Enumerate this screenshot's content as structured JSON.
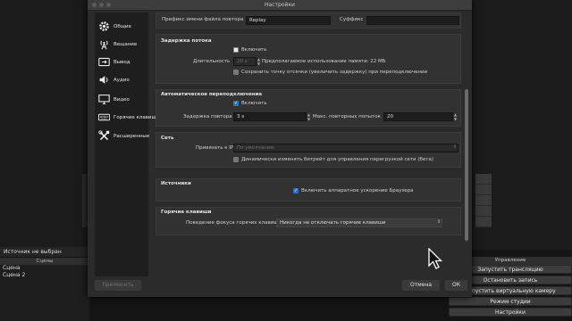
{
  "dialog": {
    "title": "Настройки",
    "buttons": {
      "apply": "Применить",
      "cancel": "Отмена",
      "ok": "ОК"
    }
  },
  "sidebar": {
    "items": [
      {
        "label": "Общие",
        "icon": "gear-icon"
      },
      {
        "label": "Вещание",
        "icon": "broadcast-icon"
      },
      {
        "label": "Вывод",
        "icon": "output-icon"
      },
      {
        "label": "Аудио",
        "icon": "speaker-icon"
      },
      {
        "label": "Видео",
        "icon": "monitor-icon"
      },
      {
        "label": "Горячие клавиши",
        "icon": "keyboard-icon"
      },
      {
        "label": "Расширенные",
        "icon": "tools-icon"
      }
    ]
  },
  "replay": {
    "prefix_label": "Префикс имени файла повтора",
    "prefix_value": "Replay",
    "suffix_label": "Суффикс",
    "suffix_value": ""
  },
  "stream_delay": {
    "title": "Задержка потока",
    "enable_label": "Включить",
    "duration_label": "Длительность",
    "duration_value": "20 s",
    "memory_text": "Предполагаемое использование памяти: 22 МБ",
    "preserve_label": "Сохранить точку отсечки (увеличить задержку) при переподключении"
  },
  "reconnect": {
    "title": "Автоматическое переподключение",
    "enable_label": "Включить",
    "retry_delay_label": "Задержка повтора",
    "retry_delay_value": "3 s",
    "max_retries_label": "Макс. повторных попыток",
    "max_retries_value": "20"
  },
  "network": {
    "title": "Сеть",
    "bind_label": "Привязать к IP",
    "bind_value": "По умолчанию",
    "dynamic_bitrate_label": "Динамически изменять битрейт для управления перегрузкой сети (бета)"
  },
  "sources": {
    "title": "Источники",
    "hw_accel_label": "Включить аппаратное ускорение Браузера"
  },
  "hotkeys": {
    "title": "Горячие клавиши",
    "focus_label": "Поведение фокуса горячих клавиш",
    "focus_value": "Никогда не отключать горячие клавиши"
  },
  "main_window": {
    "source_status": "Источник не выбран",
    "scenes_header": "Сцены",
    "scenes": [
      "Сцена",
      "Сцена 2"
    ],
    "controls_header": "Управление",
    "controls": [
      "Запустить трансляцию",
      "Остановить запись",
      "Запустить виртуальную камеру",
      "Режим студии",
      "Настройки"
    ]
  },
  "colors": {
    "accent": "#2f6fd6",
    "dialog_bg": "#2b2b2b",
    "group_bg": "#323232",
    "sidebar_bg": "#1e1e1e"
  }
}
